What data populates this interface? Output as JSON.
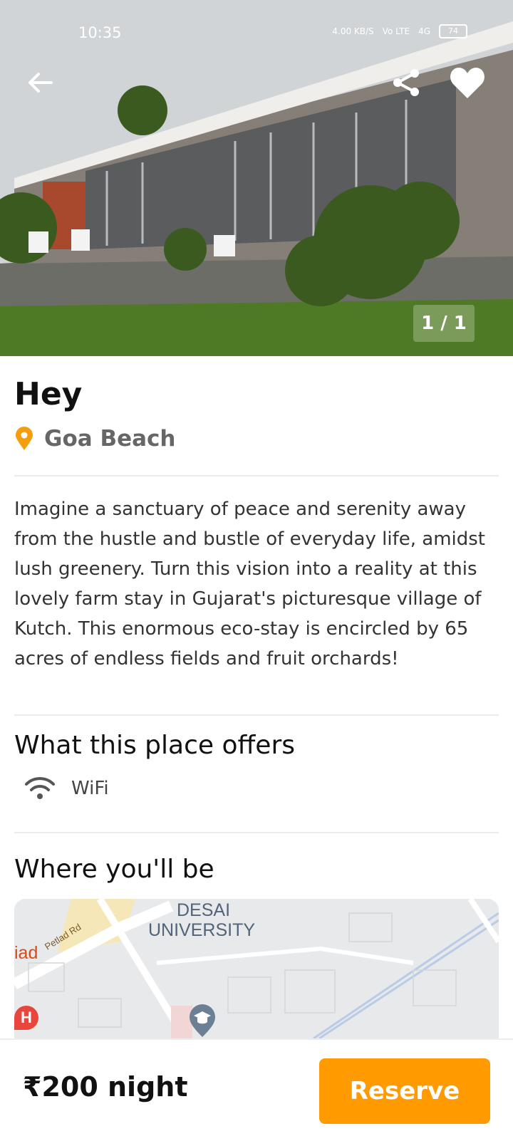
{
  "status": {
    "time": "10:35",
    "net_speed": "4.00 KB/S",
    "volte": "Vo LTE",
    "network": "4G",
    "battery": "74"
  },
  "hero": {
    "counter": "1 / 1",
    "back_icon": "arrow-left-icon",
    "share_icon": "share-icon",
    "favorite_icon": "heart-icon"
  },
  "listing": {
    "title": "Hey",
    "location": "Goa Beach",
    "description": "Imagine a sanctuary of peace and serenity away from the hustle and bustle of everyday life, amidst lush greenery. Turn this vision into a reality at this lovely farm stay in Gujarat's picturesque village of Kutch. This enormous eco-stay is encircled by 65 acres of endless fields and fruit orchards!"
  },
  "offers": {
    "heading": "What this place offers",
    "items": [
      {
        "icon": "wifi-icon",
        "label": "WiFi"
      }
    ]
  },
  "where": {
    "heading": "Where you'll be",
    "map": {
      "university_line1": "DESAI",
      "university_line2": "UNIVERSITY",
      "road": "Petlad Rd",
      "place_partial": "iad",
      "hospital_marker": "H"
    }
  },
  "footer": {
    "price": "₹200 night",
    "reserve_label": "Reserve"
  },
  "colors": {
    "accent": "#ff9a00",
    "location_pin": "#f59e0b",
    "text_dark": "#111111",
    "text_muted": "#666666"
  }
}
